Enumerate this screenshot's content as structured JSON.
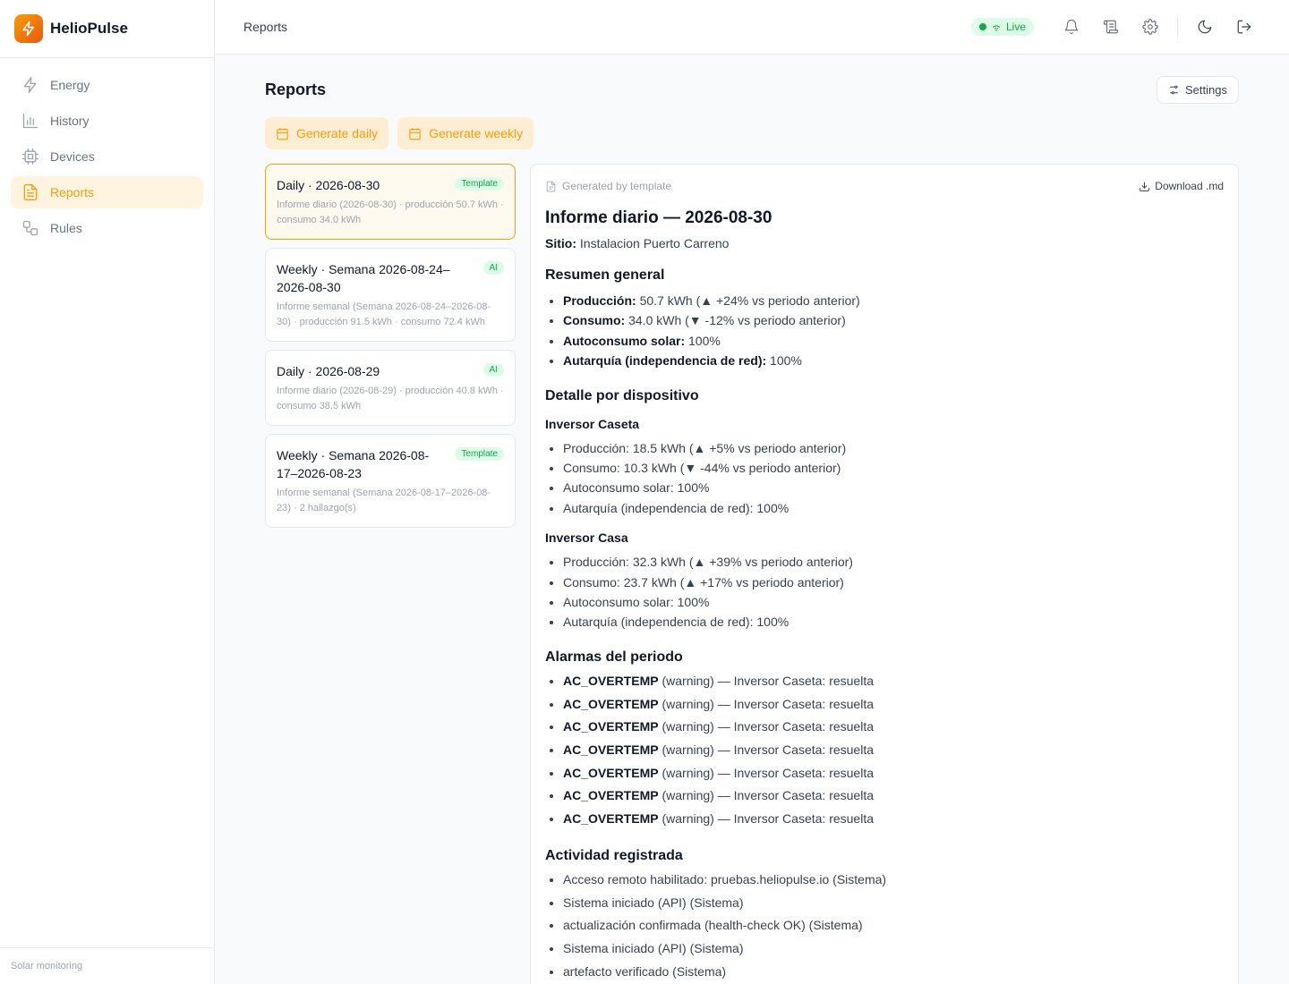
{
  "app": {
    "name": "HelioPulse",
    "footer": "Solar monitoring"
  },
  "sidebar": {
    "items": [
      {
        "label": "Energy",
        "icon": "bolt-icon"
      },
      {
        "label": "History",
        "icon": "bar-chart-icon"
      },
      {
        "label": "Devices",
        "icon": "cpu-icon"
      },
      {
        "label": "Reports",
        "icon": "document-icon",
        "active": true
      },
      {
        "label": "Rules",
        "icon": "workflow-icon"
      }
    ]
  },
  "topbar": {
    "title": "Reports",
    "live_label": "Live"
  },
  "page": {
    "title": "Reports",
    "settings_label": "Settings",
    "generate_daily": "Generate daily",
    "generate_weekly": "Generate weekly"
  },
  "reports": [
    {
      "title": "Daily · 2026-08-30",
      "badge": "Template",
      "desc": "Informe diario (2026-08-30) · producción 50.7 kWh · consumo 34.0 kWh",
      "selected": true
    },
    {
      "title": "Weekly · Semana 2026-08-24–2026-08-30",
      "badge": "AI",
      "desc": "Informe semanal (Semana 2026-08-24–2026-08-30) · producción 91.5 kWh · consumo 72.4 kWh"
    },
    {
      "title": "Daily · 2026-08-29",
      "badge": "AI",
      "desc": "Informe diario (2026-08-29) · producción 40.8 kWh · consumo 38.5 kWh"
    },
    {
      "title": "Weekly · Semana 2026-08-17–2026-08-23",
      "badge": "Template",
      "desc": "Informe semanal (Semana 2026-08-17–2026-08-23) · 2 hallazgo(s)"
    }
  ],
  "detail": {
    "generated_by": "Generated by template",
    "download_label": "Download .md",
    "title": "Informe diario — 2026-08-30",
    "site_label": "Sitio:",
    "site_value": "Instalacion Puerto Carreno",
    "summary_heading": "Resumen general",
    "summary": [
      {
        "label": "Producción:",
        "value": "50.7 kWh (▲ +24% vs periodo anterior)"
      },
      {
        "label": "Consumo:",
        "value": "34.0 kWh (▼ -12% vs periodo anterior)"
      },
      {
        "label": "Autoconsumo solar:",
        "value": "100%"
      },
      {
        "label": "Autarquía (independencia de red):",
        "value": "100%"
      }
    ],
    "devices_heading": "Detalle por dispositivo",
    "devices": [
      {
        "name": "Inversor Caseta",
        "items": [
          "Producción: 18.5 kWh (▲ +5% vs periodo anterior)",
          "Consumo: 10.3 kWh (▼ -44% vs periodo anterior)",
          "Autoconsumo solar: 100%",
          "Autarquía (independencia de red): 100%"
        ]
      },
      {
        "name": "Inversor Casa",
        "items": [
          "Producción: 32.3 kWh (▲ +39% vs periodo anterior)",
          "Consumo: 23.7 kWh (▲ +17% vs periodo anterior)",
          "Autoconsumo solar: 100%",
          "Autarquía (independencia de red): 100%"
        ]
      }
    ],
    "alarms_heading": "Alarmas del periodo",
    "alarms": [
      {
        "code": "AC_OVERTEMP",
        "text": "(warning) — Inversor Caseta: resuelta"
      },
      {
        "code": "AC_OVERTEMP",
        "text": "(warning) — Inversor Caseta: resuelta"
      },
      {
        "code": "AC_OVERTEMP",
        "text": "(warning) — Inversor Caseta: resuelta"
      },
      {
        "code": "AC_OVERTEMP",
        "text": "(warning) — Inversor Caseta: resuelta"
      },
      {
        "code": "AC_OVERTEMP",
        "text": "(warning) — Inversor Caseta: resuelta"
      },
      {
        "code": "AC_OVERTEMP",
        "text": "(warning) — Inversor Caseta: resuelta"
      },
      {
        "code": "AC_OVERTEMP",
        "text": "(warning) — Inversor Caseta: resuelta"
      }
    ],
    "activity_heading": "Actividad registrada",
    "activity": [
      "Acceso remoto habilitado: pruebas.heliopulse.io (Sistema)",
      "Sistema iniciado (API) (Sistema)",
      "actualización confirmada (health-check OK) (Sistema)",
      "Sistema iniciado (API) (Sistema)",
      "artefacto verificado (Sistema)"
    ]
  },
  "colors": {
    "accent": "#f59e0b",
    "badge_green": "#16a34a"
  }
}
